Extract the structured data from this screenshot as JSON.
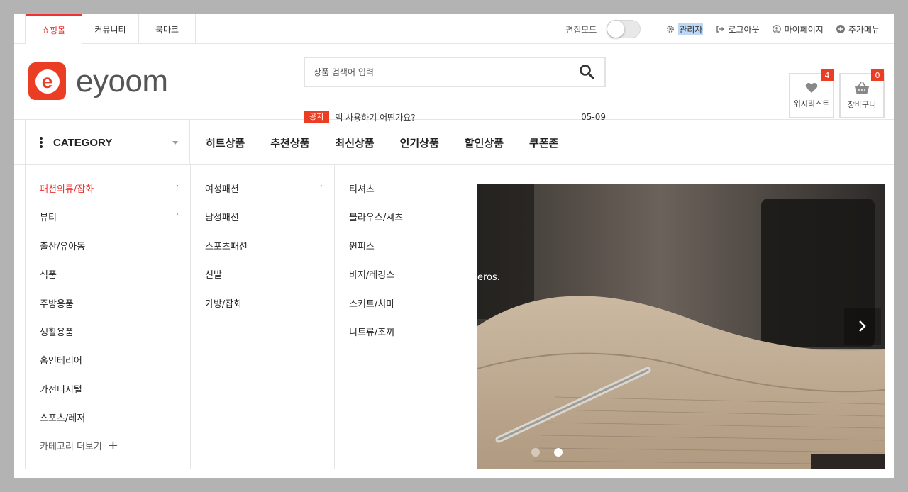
{
  "topbar": {
    "tabs": [
      {
        "label": "쇼핑몰",
        "active": true
      },
      {
        "label": "커뮤니티",
        "active": false
      },
      {
        "label": "북마크",
        "active": false
      }
    ],
    "edit_mode_label": "편집모드",
    "edit_mode_on": false,
    "links": [
      {
        "label": "관리자",
        "icon": "gear-icon"
      },
      {
        "label": "로그아웃",
        "icon": "logout-icon"
      },
      {
        "label": "마이페이지",
        "icon": "user-icon"
      },
      {
        "label": "추가메뉴",
        "icon": "plus-circle-icon"
      }
    ]
  },
  "header": {
    "logo_text": "eyoom",
    "logo_letter": "e",
    "search_placeholder": "상품 검색어 입력",
    "notice": {
      "badge": "공지",
      "text": "맥 사용하기 어떤가요?",
      "date": "05-09"
    },
    "wishlist": {
      "label": "위시리스트",
      "count": "4"
    },
    "cart": {
      "label": "장바구니",
      "count": "0"
    }
  },
  "nav": {
    "category_label": "CATEGORY",
    "items": [
      "히트상품",
      "추천상품",
      "최신상품",
      "인기상품",
      "할인상품",
      "쿠폰존"
    ]
  },
  "categories": {
    "level1": [
      "패션의류/잡화",
      "뷰티",
      "출산/유아동",
      "식품",
      "주방용품",
      "생활용품",
      "홈인테리어",
      "가전디지털",
      "스포츠/레저"
    ],
    "more_label": "카테고리 더보기",
    "level2": [
      "여성패션",
      "남성패션",
      "스포츠패션",
      "신발",
      "가방/잡화"
    ],
    "level3": [
      "티셔츠",
      "블라우스/셔츠",
      "원피스",
      "바지/레깅스",
      "스커트/치마",
      "니트류/조끼"
    ]
  },
  "slider": {
    "caption": "eros.",
    "slide_count": 2,
    "active_index": 1
  },
  "colors": {
    "accent": "#ea3d24",
    "active_text": "#ee3333"
  }
}
